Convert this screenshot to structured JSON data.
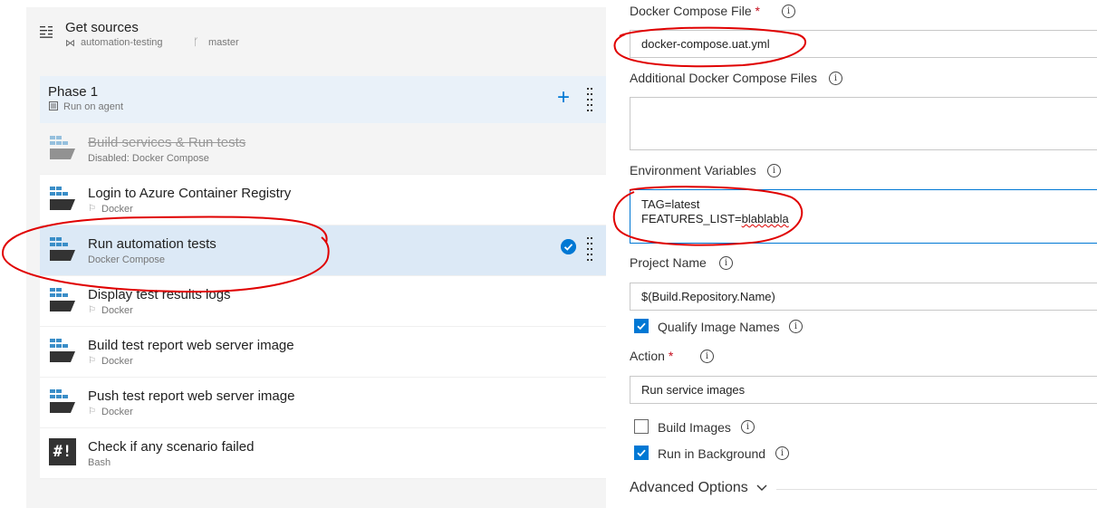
{
  "get_sources": {
    "title": "Get sources",
    "repo": "automation-testing",
    "branch": "master"
  },
  "phase": {
    "title": "Phase 1",
    "subtitle": "Run on agent"
  },
  "tasks": [
    {
      "title": "Build services & Run tests",
      "subtitle": "Disabled: Docker Compose",
      "state": "disabled"
    },
    {
      "title": "Login to Azure Container Registry",
      "subtitle": "Docker",
      "state": "normal"
    },
    {
      "title": "Run automation tests",
      "subtitle": "Docker Compose",
      "state": "selected"
    },
    {
      "title": "Display test results logs",
      "subtitle": "Docker",
      "state": "normal"
    },
    {
      "title": "Build test report web server image",
      "subtitle": "Docker",
      "state": "normal"
    },
    {
      "title": "Push test report web server image",
      "subtitle": "Docker",
      "state": "normal"
    },
    {
      "title": "Check if any scenario failed",
      "subtitle": "Bash",
      "state": "normal"
    }
  ],
  "form": {
    "compose_file": {
      "label": "Docker Compose File",
      "required_mark": "*",
      "value": "docker-compose.uat.yml"
    },
    "additional_files": {
      "label": "Additional Docker Compose Files",
      "value": ""
    },
    "env_vars": {
      "label": "Environment Variables",
      "line1": "TAG=latest",
      "line2_prefix": "FEATURES_LIST=",
      "line2_misspelled": "blablabla"
    },
    "project_name": {
      "label": "Project Name",
      "value": "$(Build.Repository.Name)"
    },
    "qualify_image_names": {
      "label": "Qualify Image Names",
      "checked": true
    },
    "action": {
      "label": "Action",
      "required_mark": "*",
      "value": "Run service images"
    },
    "build_images": {
      "label": "Build Images",
      "checked": false
    },
    "run_in_background": {
      "label": "Run in Background",
      "checked": true
    },
    "advanced_options": {
      "label": "Advanced Options"
    }
  },
  "colors": {
    "accent": "#0078d4",
    "annotation_red": "#e00000",
    "required": "#c50f1f"
  },
  "icons": {
    "get_sources": "source-list-icon",
    "repo": "visual-studio-icon",
    "branch": "branch-icon",
    "phase_agent": "agent-icon",
    "docker_task": "docker-icon",
    "bash_task": "bash-icon",
    "info": "info-icon",
    "check": "check-circle-icon",
    "chevron": "chevron-down-icon",
    "grip": "drag-handle-icon"
  }
}
